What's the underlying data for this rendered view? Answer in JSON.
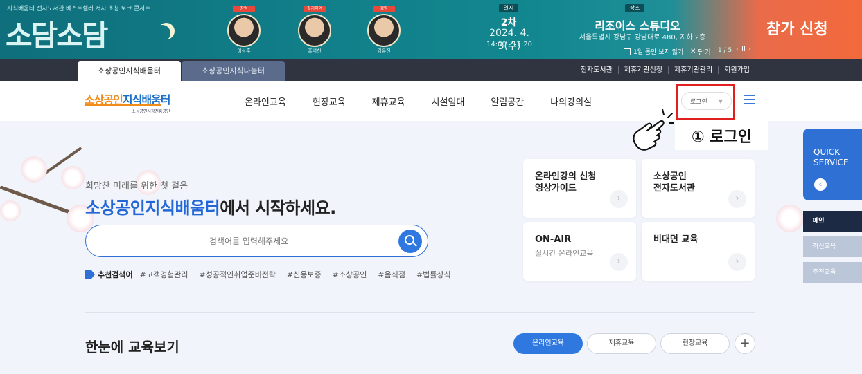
{
  "banner": {
    "tagline": "지식배움터 전자도서관 베스트셀러 저자 초청 토크 콘서트",
    "logo": "소담소담",
    "speakers": [
      {
        "role": "창업",
        "name": "이상훈"
      },
      {
        "role": "필기하여",
        "name": "홍석천"
      },
      {
        "role": "경영",
        "name": "김유진"
      }
    ],
    "date_label": "일시",
    "round": "2차",
    "date": "2024. 4. 3(수)",
    "time": "14:00~17:20",
    "place_label": "장소",
    "place": "리조이스 스튜디오",
    "address": "서울특별시 강남구 강남대로 480, 지하 2층",
    "apply": "참가 신청",
    "hide_today": "1일 동안 보지 않기",
    "close": "닫기",
    "pager": "1 / 5",
    "pager_controls": [
      "‹",
      "II",
      "›"
    ]
  },
  "site_tabs": {
    "active": "소상공인지식배움터",
    "inactive": "소상공인지식나눔터"
  },
  "util_links": [
    "전자도서관",
    "제휴기관신청",
    "제휴기관관리",
    "회원가입"
  ],
  "brand": {
    "prefix": "소상공인",
    "main": "지식배움터",
    "sub": "소상공인시장진흥공단"
  },
  "nav": [
    "온라인교육",
    "현장교육",
    "제휴교육",
    "시설임대",
    "알림공간",
    "나의강의실"
  ],
  "login": {
    "label": "로그인",
    "caret": "▼"
  },
  "annotation": "① 로그인",
  "hero": {
    "subtitle": "희망찬 미래를 위한 첫 걸음",
    "title_highlight": "소상공인지식배움터",
    "title_rest": "에서 시작하세요."
  },
  "search": {
    "placeholder": "검색어를 입력해주세요"
  },
  "keywords": {
    "label": "추천검색어",
    "items": [
      "#고객경험관리",
      "#성공적인취업준비전략",
      "#신용보증",
      "#소상공인",
      "#음식점",
      "#법률상식"
    ]
  },
  "cards": [
    {
      "title_line1": "온라인강의 신청",
      "title_line2": "영상가이드",
      "subtitle": ""
    },
    {
      "title_line1": "소상공인",
      "title_line2": "전자도서관",
      "subtitle": ""
    },
    {
      "title_line1": "ON-AIR",
      "title_line2": "",
      "subtitle": "실시간 온라인교육"
    },
    {
      "title_line1": "비대면 교육",
      "title_line2": "",
      "subtitle": ""
    }
  ],
  "card_arrow": "›",
  "quick_service": {
    "line1": "QUICK",
    "line2": "SERVICE",
    "button": "‹"
  },
  "side_menu": [
    "메인",
    "최신교육",
    "추천교육"
  ],
  "section": {
    "title": "한눈에 교육보기",
    "tabs": [
      "온라인교육",
      "제휴교육",
      "현장교육"
    ],
    "more": "+"
  },
  "colors": {
    "accent": "#2f78e0",
    "highlight_box": "#e0201e",
    "dark_bar": "#2f3440"
  }
}
